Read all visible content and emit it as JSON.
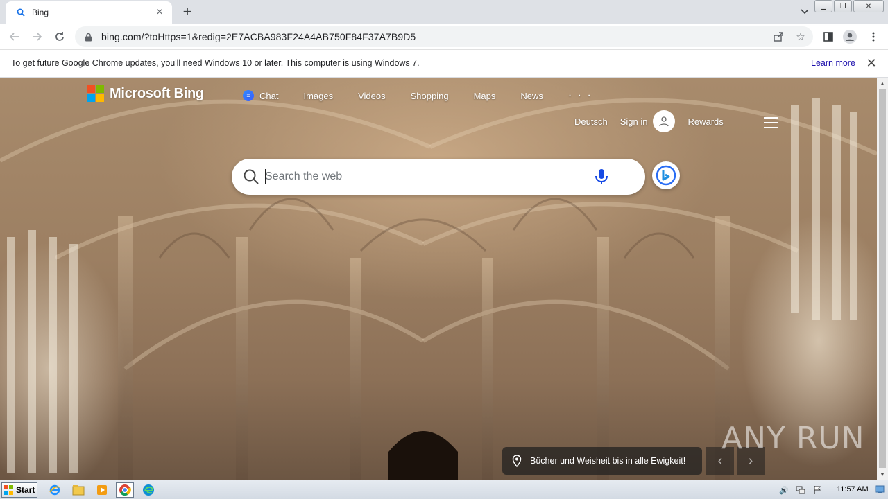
{
  "browser": {
    "tab": {
      "title": "Bing",
      "favicon": "search-icon"
    },
    "new_tab_label": "+",
    "url": "bing.com/?toHttps=1&redig=2E7ACBA983F24A4AB750F84F37A7B9D5"
  },
  "infobar": {
    "message": "To get future Google Chrome updates, you'll need Windows 10 or later. This computer is using Windows 7.",
    "link": "Learn more"
  },
  "bing": {
    "logo": "Microsoft Bing",
    "nav": [
      "Chat",
      "Images",
      "Videos",
      "Shopping",
      "Maps",
      "News"
    ],
    "nav_more": "· · ·",
    "language": "Deutsch",
    "sign_in": "Sign in",
    "rewards": "Rewards",
    "search_placeholder": "Search the web",
    "caption": "Bücher und Weisheit bis in alle Ewigkeit!",
    "watermark": "ANY RUN"
  },
  "taskbar": {
    "start": "Start",
    "clock": "11:57 AM"
  },
  "colors": {
    "ms_red": "#f25022",
    "ms_green": "#7fba00",
    "ms_blue": "#00a4ef",
    "ms_yellow": "#ffb900",
    "link_blue": "#1a0dab"
  }
}
